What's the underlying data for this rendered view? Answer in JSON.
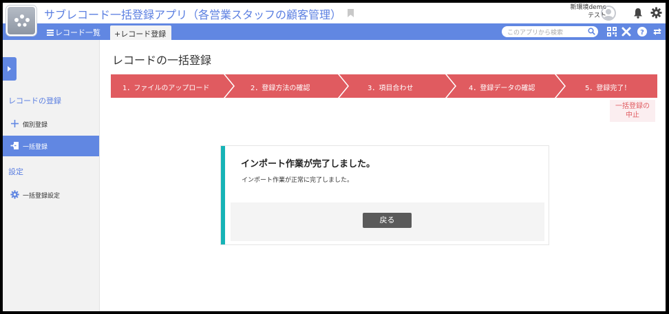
{
  "header": {
    "app_title": "サブレコード一括登録アプリ（各営業スタッフの顧客管理）",
    "user_env": "新環境demo",
    "user_name": "テスト"
  },
  "nav": {
    "record_list": "レコード一覧",
    "active_tab": "+レコード登録",
    "search_placeholder": "このアプリから検索"
  },
  "sidebar": {
    "section_record": "レコードの登録",
    "item_single": "個別登録",
    "item_bulk": "一括登録",
    "section_settings": "設定",
    "item_bulk_settings": "一括登録設定"
  },
  "main": {
    "page_title": "レコードの一括登録",
    "steps": [
      "1．ファイルのアップロード",
      "2．登録方法の確認",
      "3．項目合わせ",
      "4．登録データの確認",
      "5．登録完了！"
    ],
    "cancel_line1": "一括登録の",
    "cancel_line2": "中止",
    "result_title": "インポート作業が完了しました。",
    "result_message": "インポート作業が正常に完了しました。",
    "back_label": "戻る"
  },
  "colors": {
    "accent_blue": "#6187e2",
    "step_red": "#e05b60",
    "success_teal": "#17b3b6"
  }
}
